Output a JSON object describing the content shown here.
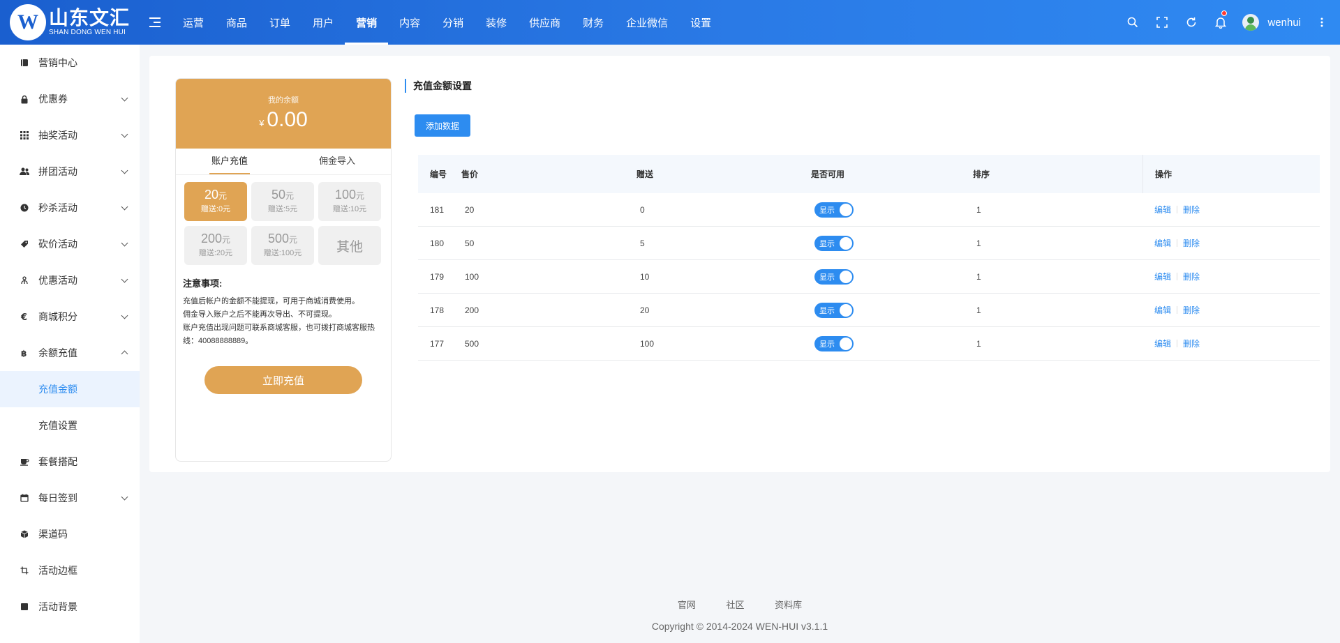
{
  "header": {
    "logo_cn": "山东文汇",
    "logo_en": "SHAN DONG WEN HUI",
    "logo_mark": "W",
    "nav": [
      "运营",
      "商品",
      "订单",
      "用户",
      "营销",
      "内容",
      "分销",
      "装修",
      "供应商",
      "财务",
      "企业微信",
      "设置"
    ],
    "active_nav": "营销",
    "username": "wenhui",
    "icons": [
      "search-icon",
      "fullscreen-icon",
      "refresh-icon",
      "bell-icon",
      "more-vertical-icon"
    ]
  },
  "sidebar": {
    "items": [
      {
        "label": "营销中心",
        "icon": "book-icon",
        "expandable": false
      },
      {
        "label": "优惠券",
        "icon": "lock-icon",
        "expandable": true
      },
      {
        "label": "抽奖活动",
        "icon": "grid-icon",
        "expandable": true
      },
      {
        "label": "拼团活动",
        "icon": "users-icon",
        "expandable": true
      },
      {
        "label": "秒杀活动",
        "icon": "clock-icon",
        "expandable": true
      },
      {
        "label": "砍价活动",
        "icon": "tag-icon",
        "expandable": true
      },
      {
        "label": "优惠活动",
        "icon": "gift-icon",
        "expandable": true
      },
      {
        "label": "商城积分",
        "icon": "euro-icon",
        "expandable": true
      },
      {
        "label": "余额充值",
        "icon": "bitcoin-icon",
        "expandable": true,
        "expanded": true,
        "children": [
          {
            "label": "充值金额",
            "active": true
          },
          {
            "label": "充值设置",
            "active": false
          }
        ]
      },
      {
        "label": "套餐搭配",
        "icon": "coffee-icon",
        "expandable": false
      },
      {
        "label": "每日签到",
        "icon": "calendar-icon",
        "expandable": true
      },
      {
        "label": "渠道码",
        "icon": "cube-icon",
        "expandable": false
      },
      {
        "label": "活动边框",
        "icon": "crop-icon",
        "expandable": false
      },
      {
        "label": "活动背景",
        "icon": "square-icon",
        "expandable": false
      }
    ]
  },
  "preview": {
    "balance_label": "我的余额",
    "currency": "¥",
    "balance": "0.00",
    "tabs": [
      "账户充值",
      "佣金导入"
    ],
    "amounts": [
      {
        "value": "20",
        "unit": "元",
        "gift": "赠送:0元",
        "active": true
      },
      {
        "value": "50",
        "unit": "元",
        "gift": "赠送:5元",
        "active": false
      },
      {
        "value": "100",
        "unit": "元",
        "gift": "赠送:10元",
        "active": false
      },
      {
        "value": "200",
        "unit": "元",
        "gift": "赠送:20元",
        "active": false
      },
      {
        "value": "500",
        "unit": "元",
        "gift": "赠送:100元",
        "active": false
      }
    ],
    "other_label": "其他",
    "notes_title": "注意事项:",
    "notes": [
      "充值后帐户的金额不能提现，可用于商城消费使用。",
      "佣金导入账户之后不能再次导出、不可提现。",
      "账户充值出现问题可联系商城客服，也可拨打商城客服热线：40088888889。"
    ],
    "recharge_button": "立即充值"
  },
  "section": {
    "title": "充值金额设置",
    "add_button": "添加数据"
  },
  "table": {
    "headers": [
      "编号",
      "售价",
      "赠送",
      "是否可用",
      "排序",
      "操作"
    ],
    "rows": [
      {
        "id": "181",
        "price": "20",
        "gift": "0",
        "status": "显示",
        "sort": "1"
      },
      {
        "id": "180",
        "price": "50",
        "gift": "5",
        "status": "显示",
        "sort": "1"
      },
      {
        "id": "179",
        "price": "100",
        "gift": "10",
        "status": "显示",
        "sort": "1"
      },
      {
        "id": "178",
        "price": "200",
        "gift": "20",
        "status": "显示",
        "sort": "1"
      },
      {
        "id": "177",
        "price": "500",
        "gift": "100",
        "status": "显示",
        "sort": "1"
      }
    ],
    "edit_label": "编辑",
    "delete_label": "删除"
  },
  "footer": {
    "links": [
      "官网",
      "社区",
      "资料库"
    ],
    "copyright": "Copyright © 2014-2024 WEN-HUI v3.1.1"
  },
  "colors": {
    "primary": "#2d8cf0",
    "header_gradient_start": "#1a5fcf",
    "accent_orange": "#e0a454"
  }
}
